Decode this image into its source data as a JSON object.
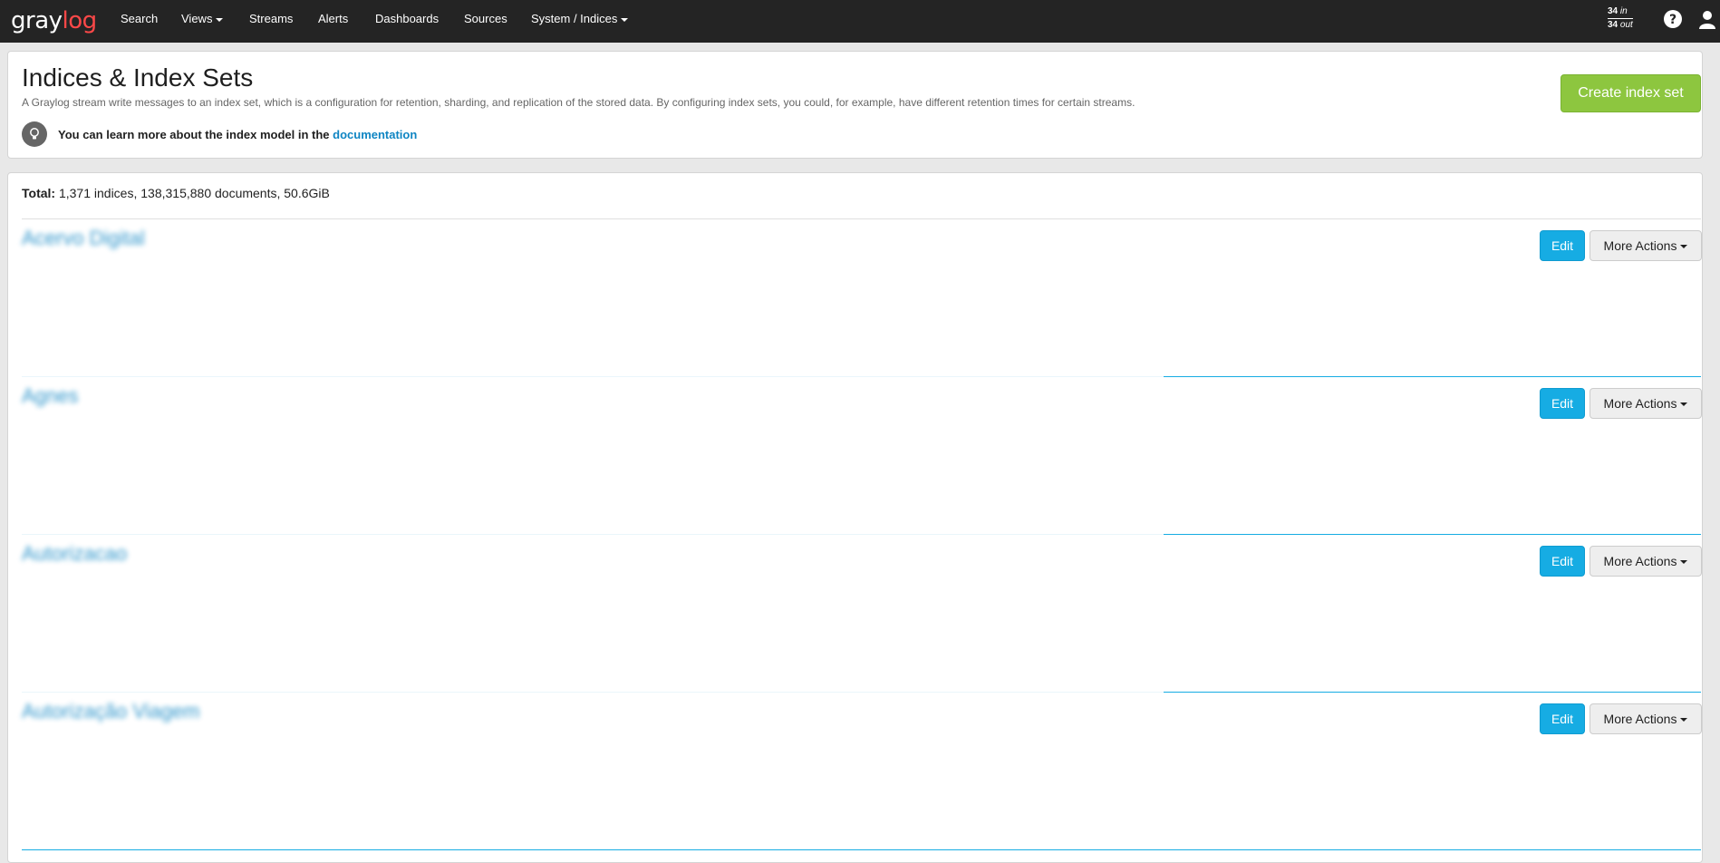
{
  "navbar": {
    "brand_part1": "gray",
    "brand_part2": "log",
    "items": [
      {
        "label": "Search"
      },
      {
        "label": "Views"
      },
      {
        "label": "Streams"
      },
      {
        "label": "Alerts"
      },
      {
        "label": "Dashboards"
      },
      {
        "label": "Sources"
      },
      {
        "label": "System / Indices"
      }
    ],
    "throughput": {
      "in_count": "34",
      "in_label": "in",
      "out_count": "34",
      "out_label": "out"
    },
    "help_icon": "question-circle-icon",
    "user_icon": "user-icon"
  },
  "header": {
    "title": "Indices & Index Sets",
    "description": "A Graylog stream write messages to an index set, which is a configuration for retention, sharding, and replication of the stored data. By configuring index sets, you could, for example, have different retention times for certain streams.",
    "tip_text": "You can learn more about the index model in the ",
    "tip_link": "documentation",
    "create_button": "Create index set"
  },
  "summary": {
    "label": "Total:",
    "value": " 1,371 indices, 138,315,880 documents, 50.6GiB"
  },
  "index_sets": [
    {
      "title": "Acervo Digital",
      "edit_label": "Edit",
      "more_label": "More Actions"
    },
    {
      "title": "Agnes",
      "edit_label": "Edit",
      "more_label": "More Actions"
    },
    {
      "title": "Autorizacao",
      "edit_label": "Edit",
      "more_label": "More Actions"
    },
    {
      "title": "Autorização Viagem",
      "edit_label": "Edit",
      "more_label": "More Actions"
    }
  ],
  "colors": {
    "navbar_bg": "#242424",
    "brand_accent": "#fc4848",
    "create_button": "#8dc63f",
    "edit_button": "#16ace3",
    "link": "#0f85c3"
  }
}
